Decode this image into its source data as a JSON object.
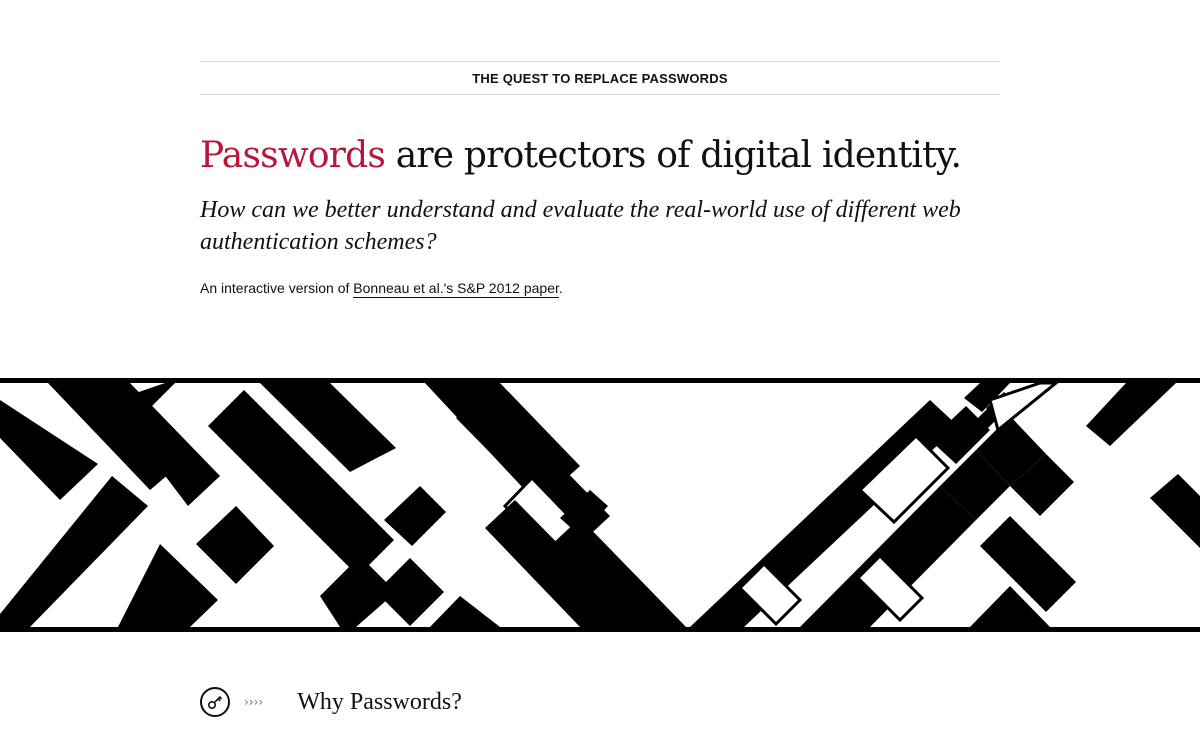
{
  "header": {
    "title": "THE QUEST TO REPLACE PASSWORDS"
  },
  "hero": {
    "headline_accent": "Passwords",
    "headline_rest": " are protectors of digital identity.",
    "subheadline": "How can we better understand and evaluate the real-world use of different web authentication schemes?",
    "intro_prefix": "An interactive version of ",
    "intro_link": "Bonneau et al.'s S&P 2012 paper",
    "intro_suffix": "."
  },
  "section": {
    "icon": "key-icon",
    "chevrons": "››››",
    "title": "Why Passwords?"
  },
  "colors": {
    "accent": "#b8173a",
    "text": "#111111",
    "rule": "#d8d8d8"
  }
}
